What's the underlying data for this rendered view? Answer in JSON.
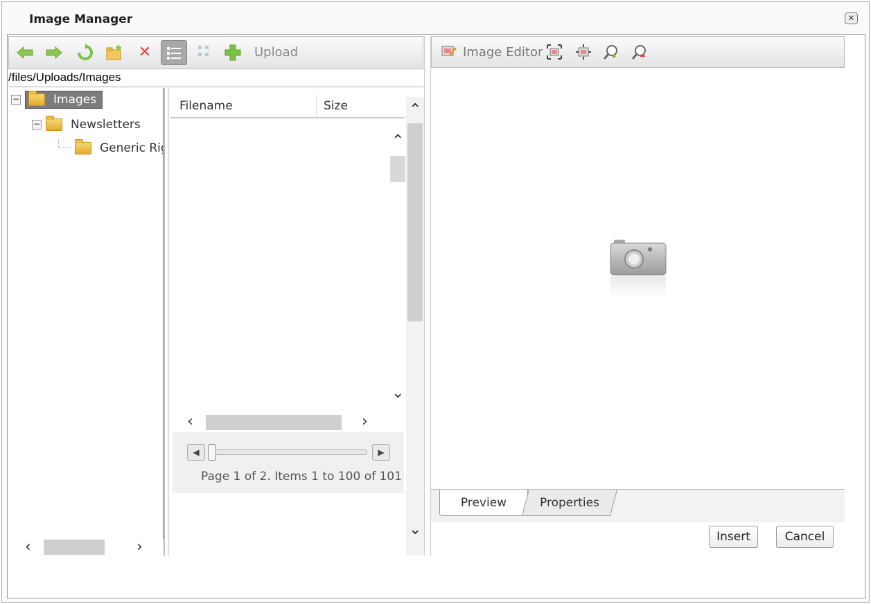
{
  "window": {
    "title": "Image Manager",
    "close_icon": "close-icon"
  },
  "left_toolbar": {
    "icons": [
      "back-arrow-icon",
      "forward-arrow-icon",
      "refresh-icon",
      "new-folder-icon",
      "delete-icon",
      "list-view-icon",
      "thumbnail-view-icon",
      "upload-icon"
    ],
    "upload_label": "Upload"
  },
  "path": "/files/Uploads/Images",
  "tree": {
    "nodes": [
      {
        "label": "Images",
        "selected": true
      },
      {
        "label": "Newsletters"
      },
      {
        "label": "Generic Rigl"
      }
    ]
  },
  "grid": {
    "columns": [
      "Filename",
      "Size"
    ]
  },
  "pager": {
    "text": "Page 1 of 2. Items 1 to 100 of 101",
    "current_page": 1,
    "total_pages": 2
  },
  "right_toolbar": {
    "image_editor_label": "Image Editor",
    "icons": [
      "image-editor-icon",
      "best-fit-icon",
      "actual-size-icon",
      "zoom-in-icon",
      "zoom-out-icon"
    ]
  },
  "preview": {
    "placeholder_icon": "camera-icon"
  },
  "tabs": [
    {
      "label": "Preview",
      "active": true
    },
    {
      "label": "Properties",
      "active": false
    }
  ],
  "buttons": {
    "insert": "Insert",
    "cancel": "Cancel"
  },
  "colors": {
    "selected_node": "#7c7c7c",
    "toolbar_bg": "#e4e4e4",
    "back_forward": "#7cc242",
    "delete": "#e0443b"
  }
}
